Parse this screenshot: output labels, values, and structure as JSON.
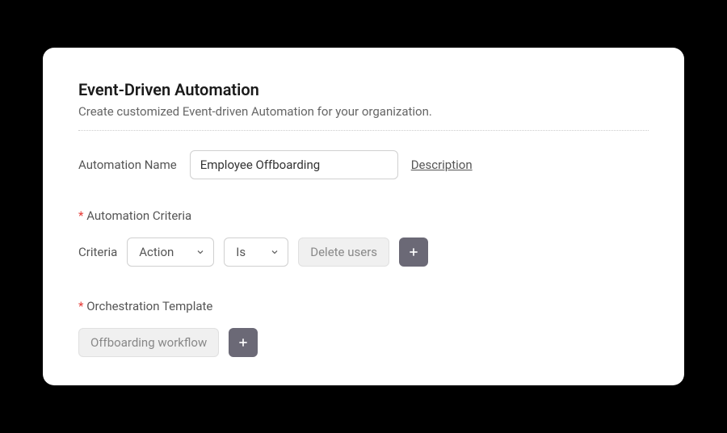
{
  "header": {
    "title": "Event-Driven Automation",
    "subtitle": "Create customized Event-driven Automation for your organization."
  },
  "nameField": {
    "label": "Automation Name",
    "value": "Employee Offboarding",
    "descriptionLink": "Description"
  },
  "criteriaSection": {
    "required": "*",
    "label": "Automation Criteria",
    "rowLabel": "Criteria",
    "field": "Action",
    "operator": "Is",
    "value": "Delete users"
  },
  "templateSection": {
    "required": "*",
    "label": "Orchestration Template",
    "value": "Offboarding workflow"
  }
}
